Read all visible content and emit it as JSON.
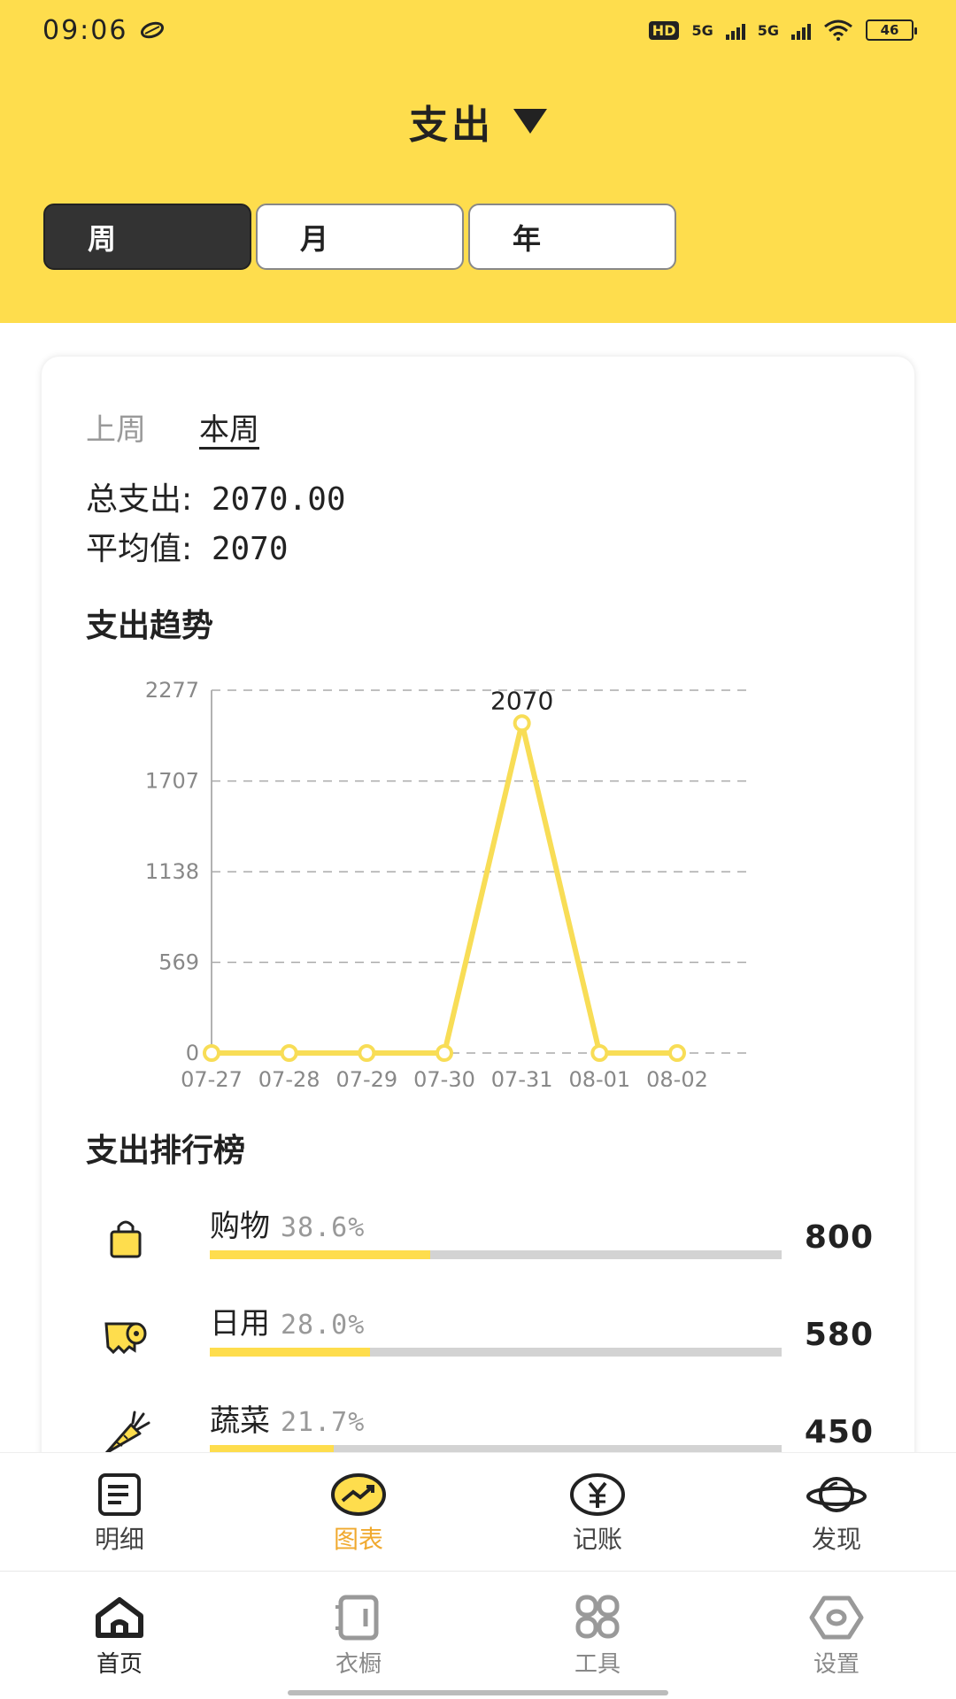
{
  "status_bar": {
    "time": "09:06",
    "network": "5G",
    "hd": "HD",
    "battery": "46"
  },
  "header": {
    "title": "支出"
  },
  "period_tabs": [
    {
      "label": "周",
      "active": true
    },
    {
      "label": "月",
      "active": false
    },
    {
      "label": "年",
      "active": false
    }
  ],
  "card": {
    "week_tabs": [
      {
        "label": "上周",
        "active": false
      },
      {
        "label": "本周",
        "active": true
      }
    ],
    "total_label": "总支出:",
    "total_value": "2070.00",
    "avg_label": "平均值:",
    "avg_value": "2070",
    "trend_title": "支出趋势",
    "ranking_title": "支出排行榜"
  },
  "chart_data": {
    "type": "line",
    "title": "支出趋势",
    "x": [
      "07-27",
      "07-28",
      "07-29",
      "07-30",
      "07-31",
      "08-01",
      "08-02"
    ],
    "series": [
      {
        "values": [
          0,
          0,
          0,
          0,
          2070,
          0,
          0
        ],
        "color": "#F8DD56"
      }
    ],
    "y_ticks": [
      "0",
      "569",
      "1138",
      "1707",
      "2277"
    ],
    "ylim": [
      0,
      2277
    ],
    "data_labels": [
      {
        "index": 4,
        "text": "2070"
      }
    ],
    "grid": "dashed horizontal"
  },
  "ranking": [
    {
      "name": "购物",
      "percent": "38.6%",
      "value": "800",
      "fraction": 0.386,
      "icon": "shopping-bag-icon"
    },
    {
      "name": "日用",
      "percent": "28.0%",
      "value": "580",
      "fraction": 0.28,
      "icon": "toilet-paper-icon"
    },
    {
      "name": "蔬菜",
      "percent": "21.7%",
      "value": "450",
      "fraction": 0.217,
      "icon": "carrot-icon"
    }
  ],
  "inner_nav": [
    {
      "label": "明细",
      "icon": "list-icon",
      "active": false
    },
    {
      "label": "图表",
      "icon": "chart-icon",
      "active": true
    },
    {
      "label": "记账",
      "icon": "yen-icon",
      "active": false
    },
    {
      "label": "发现",
      "icon": "planet-icon",
      "active": false
    }
  ],
  "outer_nav": [
    {
      "label": "首页",
      "icon": "home-icon",
      "active": true
    },
    {
      "label": "衣橱",
      "icon": "wardrobe-icon",
      "active": false
    },
    {
      "label": "工具",
      "icon": "tools-grid-icon",
      "active": false
    },
    {
      "label": "设置",
      "icon": "settings-hex-icon",
      "active": false
    }
  ],
  "colors": {
    "accent": "#FEDD4D",
    "nav_active": "#F0A92E",
    "dark": "#333333"
  }
}
